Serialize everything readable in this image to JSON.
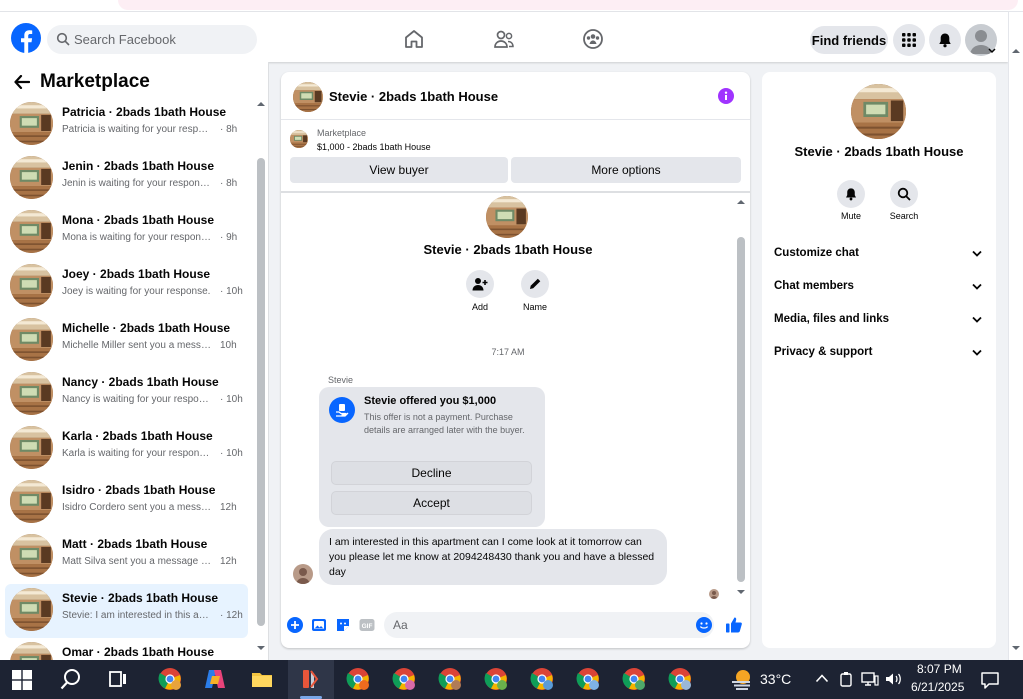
{
  "header": {
    "search_placeholder": "Search Facebook",
    "find_friends_label": "Find friends"
  },
  "marketplace": {
    "title": "Marketplace",
    "conversations": [
      {
        "title": "Patricia · 2bads 1bath House",
        "subtitle": "Patricia is waiting for your response.",
        "time": "· 8h"
      },
      {
        "title": "Jenin · 2bads 1bath House",
        "subtitle": "Jenin is waiting for your response.",
        "time": "· 8h"
      },
      {
        "title": "Mona · 2bads 1bath House",
        "subtitle": "Mona is waiting for your response.",
        "time": "· 9h"
      },
      {
        "title": "Joey · 2bads 1bath House",
        "subtitle": "Joey is waiting for your response.",
        "time": "· 10h"
      },
      {
        "title": "Michelle · 2bads 1bath House",
        "subtitle": "Michelle Miller sent you a messa...",
        "time": "10h"
      },
      {
        "title": "Nancy · 2bads 1bath House",
        "subtitle": "Nancy is waiting for your respon...",
        "time": "· 10h"
      },
      {
        "title": "Karla · 2bads 1bath House",
        "subtitle": "Karla is waiting for your response.",
        "time": "· 10h"
      },
      {
        "title": "Isidro · 2bads 1bath House",
        "subtitle": "Isidro Cordero sent you a messa...",
        "time": "12h"
      },
      {
        "title": "Matt · 2bads 1bath House",
        "subtitle": "Matt Silva sent you a message ab...",
        "time": "12h"
      },
      {
        "title": "Stevie · 2bads 1bath House",
        "subtitle": "Stevie: I am interested in this apa...",
        "time": "· 12h"
      },
      {
        "title": "Omar · 2bads 1bath House",
        "subtitle": "",
        "time": ""
      }
    ]
  },
  "chat": {
    "title": "Stevie · 2bads 1bath House",
    "listing_source": "Marketplace",
    "listing_title": "$1,000 - 2bads 1bath House",
    "view_buyer_label": "View buyer",
    "more_options_label": "More options",
    "profile_name": "Stevie · 2bads 1bath House",
    "add_label": "Add",
    "name_label": "Name",
    "timestamp": "7:17 AM",
    "sender_name": "Stevie",
    "offer_title": "Stevie offered you $1,000",
    "offer_desc": "This offer is not a payment. Purchase details are arranged later with the buyer.",
    "decline_label": "Decline",
    "accept_label": "Accept",
    "message_text": "I am interested in this apartment can I come look at it tomorrow can you please let me know at 2094248430 thank you and have a blessed day",
    "composer_placeholder": "Aa"
  },
  "right_panel": {
    "name": "Stevie · 2bads 1bath House",
    "mute_label": "Mute",
    "search_label": "Search",
    "rows": [
      "Customize chat",
      "Chat members",
      "Media, files and links",
      "Privacy & support"
    ]
  },
  "taskbar": {
    "temperature": "33°C",
    "time": "8:07 PM",
    "date": "6/21/2025"
  },
  "colors": {
    "facebook_blue": "#0866ff",
    "info_purple": "#a033ff",
    "active_conversation_bg": "#e7f3ff",
    "taskbar_bg": "#1d2333"
  }
}
